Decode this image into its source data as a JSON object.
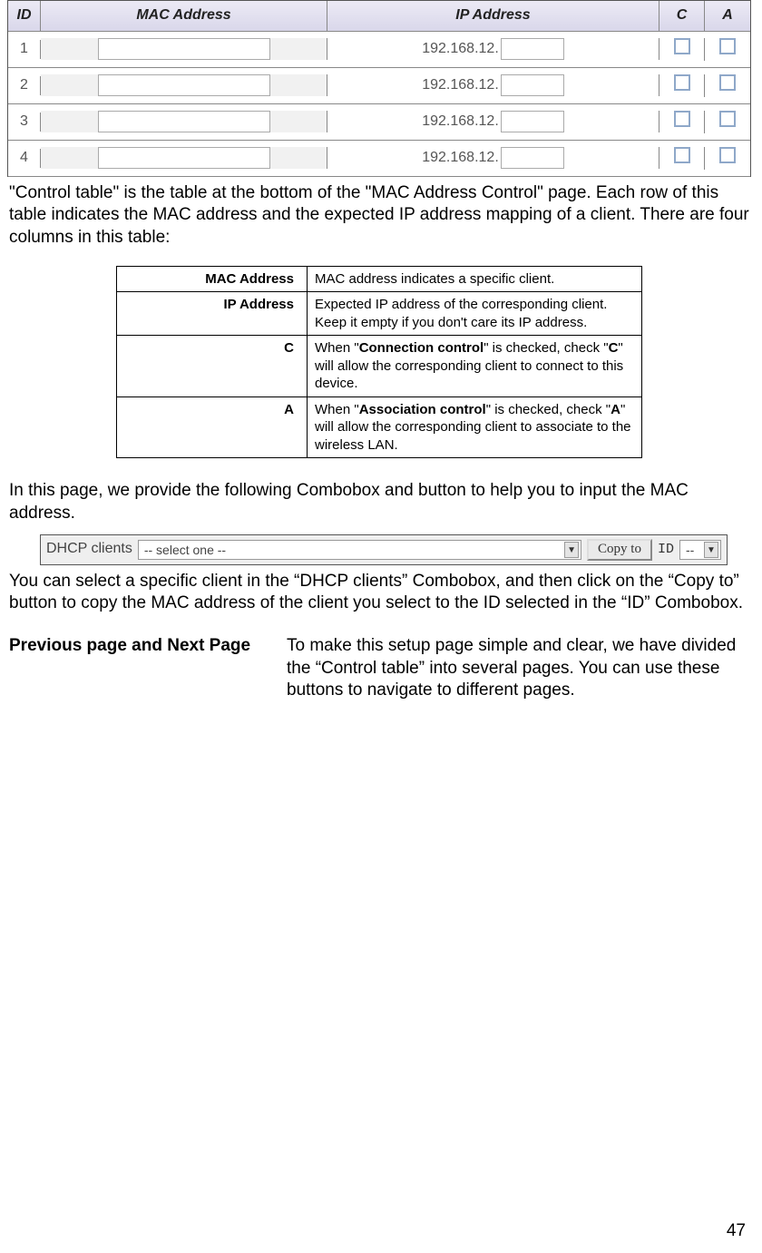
{
  "control_table": {
    "headers": {
      "id": "ID",
      "mac": "MAC Address",
      "ip": "IP Address",
      "c": "C",
      "a": "A"
    },
    "ip_prefix": "192.168.12.",
    "rows": [
      {
        "id": "1",
        "mac": "",
        "ip": "",
        "c": false,
        "a": false
      },
      {
        "id": "2",
        "mac": "",
        "ip": "",
        "c": false,
        "a": false
      },
      {
        "id": "3",
        "mac": "",
        "ip": "",
        "c": false,
        "a": false
      },
      {
        "id": "4",
        "mac": "",
        "ip": "",
        "c": false,
        "a": false
      }
    ]
  },
  "para1": "\"Control table\" is the table at the bottom of the \"MAC Address Control\" page. Each row of this table indicates the MAC address and the expected IP address mapping of a client. There are four columns in this table:",
  "def_table": [
    {
      "k": "MAC Address",
      "v_parts": [
        [
          "",
          "MAC address indicates a specific client."
        ]
      ]
    },
    {
      "k": "IP Address",
      "v_parts": [
        [
          "",
          "Expected IP address of the corresponding client. Keep it empty if you don't care its IP address."
        ]
      ]
    },
    {
      "k": "C",
      "v_parts": [
        [
          "",
          "When \""
        ],
        [
          "b",
          "Connection control"
        ],
        [
          "",
          "\" is checked, check \""
        ],
        [
          "b",
          "C"
        ],
        [
          "",
          "\" will allow the corresponding client to connect to this device."
        ]
      ]
    },
    {
      "k": "A",
      "v_parts": [
        [
          "",
          "When \""
        ],
        [
          "b",
          "Association control"
        ],
        [
          "",
          "\" is checked, check \""
        ],
        [
          "b",
          "A"
        ],
        [
          "",
          "\" will allow the corresponding client to associate to the wireless LAN."
        ]
      ]
    }
  ],
  "para2": "In this page, we provide the following Combobox and button to help you to input the MAC address.",
  "combo": {
    "label": "DHCP clients",
    "select_value": "-- select one --",
    "button": "Copy to",
    "id_label": "ID",
    "id_value": "--"
  },
  "para3": "You can select a specific client in the “DHCP clients” Combobox, and then click on the “Copy to” button to copy the MAC address of the client you select to the ID selected in the “ID” Combobox.",
  "twocol": {
    "left": "Previous page and Next Page",
    "right": "To make this setup page simple and clear, we have divided the “Control table” into several pages. You can use these buttons to navigate to different pages."
  },
  "page_number": "47"
}
